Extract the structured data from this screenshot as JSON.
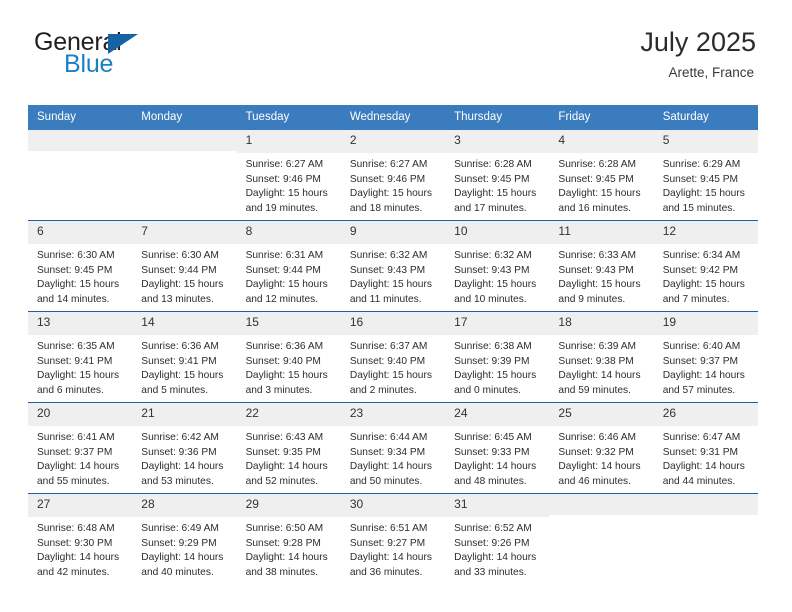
{
  "brand": {
    "name_top": "General",
    "name_bottom": "Blue",
    "triangle_color": "#1464a5",
    "blue_color": "#1b7fc4"
  },
  "header": {
    "title": "July 2025",
    "location": "Arette, France"
  },
  "theme": {
    "header_row_bg": "#3b7cbf",
    "week_divider": "#1f5fa0",
    "day_number_bg": "#efefef"
  },
  "calendar": {
    "weekday_headers": [
      "Sunday",
      "Monday",
      "Tuesday",
      "Wednesday",
      "Thursday",
      "Friday",
      "Saturday"
    ],
    "weeks": [
      [
        {
          "day": "",
          "empty": true,
          "sunrise": "",
          "sunset": "",
          "daylight_line1": "",
          "daylight_line2": ""
        },
        {
          "day": "",
          "empty": true,
          "sunrise": "",
          "sunset": "",
          "daylight_line1": "",
          "daylight_line2": ""
        },
        {
          "day": "1",
          "sunrise": "Sunrise: 6:27 AM",
          "sunset": "Sunset: 9:46 PM",
          "daylight_line1": "Daylight: 15 hours",
          "daylight_line2": "and 19 minutes."
        },
        {
          "day": "2",
          "sunrise": "Sunrise: 6:27 AM",
          "sunset": "Sunset: 9:46 PM",
          "daylight_line1": "Daylight: 15 hours",
          "daylight_line2": "and 18 minutes."
        },
        {
          "day": "3",
          "sunrise": "Sunrise: 6:28 AM",
          "sunset": "Sunset: 9:45 PM",
          "daylight_line1": "Daylight: 15 hours",
          "daylight_line2": "and 17 minutes."
        },
        {
          "day": "4",
          "sunrise": "Sunrise: 6:28 AM",
          "sunset": "Sunset: 9:45 PM",
          "daylight_line1": "Daylight: 15 hours",
          "daylight_line2": "and 16 minutes."
        },
        {
          "day": "5",
          "sunrise": "Sunrise: 6:29 AM",
          "sunset": "Sunset: 9:45 PM",
          "daylight_line1": "Daylight: 15 hours",
          "daylight_line2": "and 15 minutes."
        }
      ],
      [
        {
          "day": "6",
          "sunrise": "Sunrise: 6:30 AM",
          "sunset": "Sunset: 9:45 PM",
          "daylight_line1": "Daylight: 15 hours",
          "daylight_line2": "and 14 minutes."
        },
        {
          "day": "7",
          "sunrise": "Sunrise: 6:30 AM",
          "sunset": "Sunset: 9:44 PM",
          "daylight_line1": "Daylight: 15 hours",
          "daylight_line2": "and 13 minutes."
        },
        {
          "day": "8",
          "sunrise": "Sunrise: 6:31 AM",
          "sunset": "Sunset: 9:44 PM",
          "daylight_line1": "Daylight: 15 hours",
          "daylight_line2": "and 12 minutes."
        },
        {
          "day": "9",
          "sunrise": "Sunrise: 6:32 AM",
          "sunset": "Sunset: 9:43 PM",
          "daylight_line1": "Daylight: 15 hours",
          "daylight_line2": "and 11 minutes."
        },
        {
          "day": "10",
          "sunrise": "Sunrise: 6:32 AM",
          "sunset": "Sunset: 9:43 PM",
          "daylight_line1": "Daylight: 15 hours",
          "daylight_line2": "and 10 minutes."
        },
        {
          "day": "11",
          "sunrise": "Sunrise: 6:33 AM",
          "sunset": "Sunset: 9:43 PM",
          "daylight_line1": "Daylight: 15 hours",
          "daylight_line2": "and 9 minutes."
        },
        {
          "day": "12",
          "sunrise": "Sunrise: 6:34 AM",
          "sunset": "Sunset: 9:42 PM",
          "daylight_line1": "Daylight: 15 hours",
          "daylight_line2": "and 7 minutes."
        }
      ],
      [
        {
          "day": "13",
          "sunrise": "Sunrise: 6:35 AM",
          "sunset": "Sunset: 9:41 PM",
          "daylight_line1": "Daylight: 15 hours",
          "daylight_line2": "and 6 minutes."
        },
        {
          "day": "14",
          "sunrise": "Sunrise: 6:36 AM",
          "sunset": "Sunset: 9:41 PM",
          "daylight_line1": "Daylight: 15 hours",
          "daylight_line2": "and 5 minutes."
        },
        {
          "day": "15",
          "sunrise": "Sunrise: 6:36 AM",
          "sunset": "Sunset: 9:40 PM",
          "daylight_line1": "Daylight: 15 hours",
          "daylight_line2": "and 3 minutes."
        },
        {
          "day": "16",
          "sunrise": "Sunrise: 6:37 AM",
          "sunset": "Sunset: 9:40 PM",
          "daylight_line1": "Daylight: 15 hours",
          "daylight_line2": "and 2 minutes."
        },
        {
          "day": "17",
          "sunrise": "Sunrise: 6:38 AM",
          "sunset": "Sunset: 9:39 PM",
          "daylight_line1": "Daylight: 15 hours",
          "daylight_line2": "and 0 minutes."
        },
        {
          "day": "18",
          "sunrise": "Sunrise: 6:39 AM",
          "sunset": "Sunset: 9:38 PM",
          "daylight_line1": "Daylight: 14 hours",
          "daylight_line2": "and 59 minutes."
        },
        {
          "day": "19",
          "sunrise": "Sunrise: 6:40 AM",
          "sunset": "Sunset: 9:37 PM",
          "daylight_line1": "Daylight: 14 hours",
          "daylight_line2": "and 57 minutes."
        }
      ],
      [
        {
          "day": "20",
          "sunrise": "Sunrise: 6:41 AM",
          "sunset": "Sunset: 9:37 PM",
          "daylight_line1": "Daylight: 14 hours",
          "daylight_line2": "and 55 minutes."
        },
        {
          "day": "21",
          "sunrise": "Sunrise: 6:42 AM",
          "sunset": "Sunset: 9:36 PM",
          "daylight_line1": "Daylight: 14 hours",
          "daylight_line2": "and 53 minutes."
        },
        {
          "day": "22",
          "sunrise": "Sunrise: 6:43 AM",
          "sunset": "Sunset: 9:35 PM",
          "daylight_line1": "Daylight: 14 hours",
          "daylight_line2": "and 52 minutes."
        },
        {
          "day": "23",
          "sunrise": "Sunrise: 6:44 AM",
          "sunset": "Sunset: 9:34 PM",
          "daylight_line1": "Daylight: 14 hours",
          "daylight_line2": "and 50 minutes."
        },
        {
          "day": "24",
          "sunrise": "Sunrise: 6:45 AM",
          "sunset": "Sunset: 9:33 PM",
          "daylight_line1": "Daylight: 14 hours",
          "daylight_line2": "and 48 minutes."
        },
        {
          "day": "25",
          "sunrise": "Sunrise: 6:46 AM",
          "sunset": "Sunset: 9:32 PM",
          "daylight_line1": "Daylight: 14 hours",
          "daylight_line2": "and 46 minutes."
        },
        {
          "day": "26",
          "sunrise": "Sunrise: 6:47 AM",
          "sunset": "Sunset: 9:31 PM",
          "daylight_line1": "Daylight: 14 hours",
          "daylight_line2": "and 44 minutes."
        }
      ],
      [
        {
          "day": "27",
          "sunrise": "Sunrise: 6:48 AM",
          "sunset": "Sunset: 9:30 PM",
          "daylight_line1": "Daylight: 14 hours",
          "daylight_line2": "and 42 minutes."
        },
        {
          "day": "28",
          "sunrise": "Sunrise: 6:49 AM",
          "sunset": "Sunset: 9:29 PM",
          "daylight_line1": "Daylight: 14 hours",
          "daylight_line2": "and 40 minutes."
        },
        {
          "day": "29",
          "sunrise": "Sunrise: 6:50 AM",
          "sunset": "Sunset: 9:28 PM",
          "daylight_line1": "Daylight: 14 hours",
          "daylight_line2": "and 38 minutes."
        },
        {
          "day": "30",
          "sunrise": "Sunrise: 6:51 AM",
          "sunset": "Sunset: 9:27 PM",
          "daylight_line1": "Daylight: 14 hours",
          "daylight_line2": "and 36 minutes."
        },
        {
          "day": "31",
          "sunrise": "Sunrise: 6:52 AM",
          "sunset": "Sunset: 9:26 PM",
          "daylight_line1": "Daylight: 14 hours",
          "daylight_line2": "and 33 minutes."
        },
        {
          "day": "",
          "empty": true,
          "sunrise": "",
          "sunset": "",
          "daylight_line1": "",
          "daylight_line2": ""
        },
        {
          "day": "",
          "empty": true,
          "sunrise": "",
          "sunset": "",
          "daylight_line1": "",
          "daylight_line2": ""
        }
      ]
    ]
  }
}
